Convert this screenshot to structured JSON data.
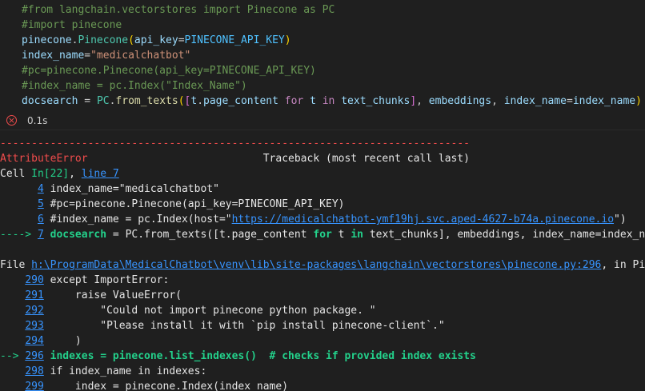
{
  "code": {
    "line1": "#from langchain.vectorstores import Pinecone as PC",
    "line2": "#import pinecone",
    "line3": {
      "obj": "pinecone",
      "dot": ".",
      "cls": "Pinecone",
      "open": "(",
      "arg": "api_key",
      "eq": "=",
      "val": "PINECONE_API_KEY",
      "close": ")"
    },
    "line4": {
      "var": "index_name",
      "eq": "=",
      "str": "\"medicalchatbot\""
    },
    "line5": "#pc=pinecone.Pinecone(api_key=PINECONE_API_KEY)",
    "line6": "#index_name = pc.Index(\"Index_Name\")",
    "line7": {
      "var": "docsearch",
      "eq": " = ",
      "cls": "PC",
      "dot": ".",
      "fn": "from_texts",
      "p1": "(",
      "b1": "[",
      "obj": "t",
      "dot2": ".",
      "attr": "page_content",
      "kw1": " for ",
      "t": "t",
      "kw2": " in ",
      "chunks": "text_chunks",
      "b2": "]",
      "sep": ", ",
      "emb": "embeddings",
      "sep2": ", ",
      "arg": "index_name",
      "eq2": "=",
      "val": "index_name",
      "p2": ")"
    }
  },
  "status": {
    "icon": "error-circle-icon",
    "glyph": "×",
    "time": "0.1s"
  },
  "output": {
    "dashes": "---------------------------------------------------------------------------",
    "error_name": "AttributeError",
    "traceback_label": "                            Traceback (most recent call last)",
    "cell_prefix": "Cell ",
    "cell_in": "In[22]",
    "cell_sep": ", ",
    "cell_line": "line 7",
    "rows1": [
      {
        "num": "4",
        "prefix": "      ",
        "text": "index_name=\"medicalchatbot\""
      },
      {
        "num": "5",
        "prefix": "      ",
        "text": "#pc=pinecone.Pinecone(api_key=PINECONE_API_KEY)"
      },
      {
        "num": "6",
        "prefix": "      ",
        "text_pre": "#index_name = pc.Index(host=\"",
        "url": "https://medicalchatbot-ymf19hj.svc.aped-4627-b74a.pinecone.io",
        "text_post": "\")"
      }
    ],
    "arrow1": "----> ",
    "arrow1_num": "7",
    "line7_out": {
      "a": "docsearch ",
      "b": "= ",
      "c": "PC.from_texts([t.page_content ",
      "kw1": "for",
      "d": " t ",
      "kw2": "in",
      "e": " text_chunks], embeddings, index_name=index_nam"
    },
    "file_prefix": "File ",
    "file_path": "h:\\ProgramData\\MedicalChatbot\\venv\\lib\\site-packages\\langchain\\vectorstores\\pinecone.py:296",
    "file_suffix": ", in Pine",
    "rows2": [
      {
        "num": "290",
        "prefix": "    ",
        "text": "except ImportError:"
      },
      {
        "num": "291",
        "prefix": "    ",
        "text": "    raise ValueError("
      },
      {
        "num": "292",
        "prefix": "    ",
        "text": "        \"Could not import pinecone python package. \""
      },
      {
        "num": "293",
        "prefix": "    ",
        "text": "        \"Please install it with `pip install pinecone-client`.\""
      },
      {
        "num": "294",
        "prefix": "    ",
        "text": "    )"
      }
    ],
    "arrow2": "--> ",
    "arrow2_num": "296",
    "line296": {
      "a": " indexes = pinecone.list_indexes()  # checks if provided index exists"
    },
    "rows3": [
      {
        "num": "298",
        "prefix": "    ",
        "text": "if index_name in indexes:"
      },
      {
        "num": "299",
        "prefix": "    ",
        "text": "    index = pinecone.Index(index_name)"
      }
    ]
  },
  "colors": {
    "background": "#1f1f1f",
    "error": "#f14c4c",
    "link": "#3794ff",
    "green": "#23d18b"
  }
}
